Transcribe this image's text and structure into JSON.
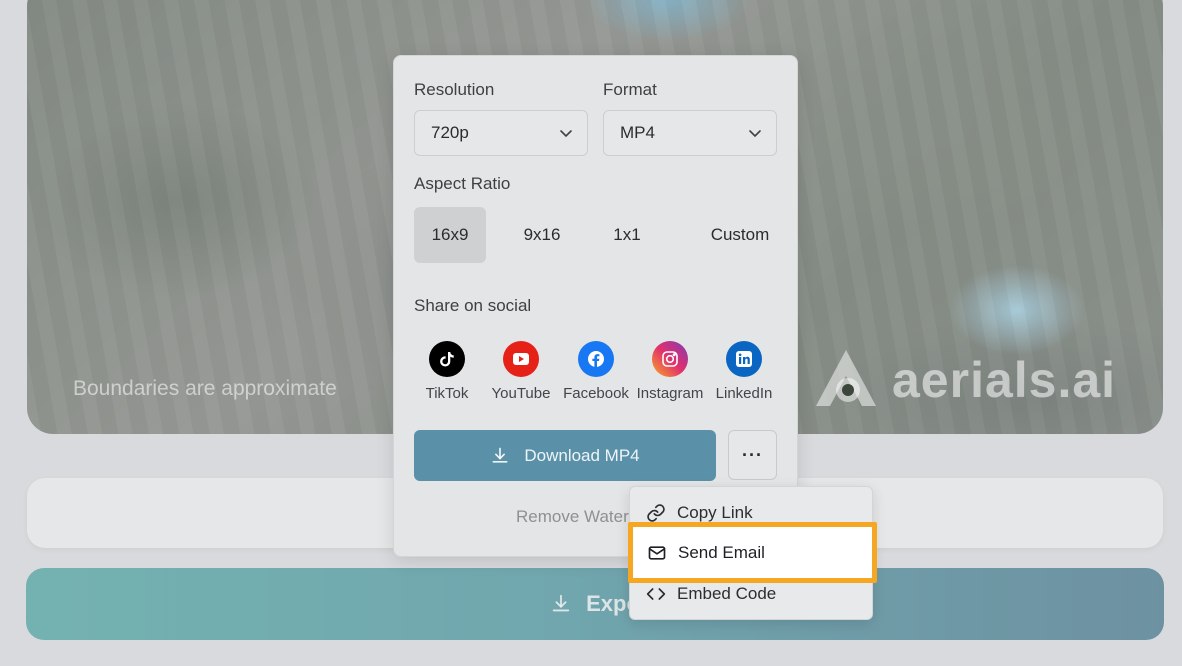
{
  "background": {
    "map_note": "Boundaries are approximate",
    "brand_name": "aerials.ai",
    "export_label": "Expo"
  },
  "panel": {
    "resolution_label": "Resolution",
    "resolution_value": "720p",
    "format_label": "Format",
    "format_value": "MP4",
    "aspect_label": "Aspect Ratio",
    "aspect_options": [
      "16x9",
      "9x16",
      "1x1",
      "Custom"
    ],
    "aspect_selected": "16x9",
    "share_label": "Share on social",
    "socials": [
      {
        "name": "TikTok",
        "color": "#000000"
      },
      {
        "name": "YouTube",
        "color": "#e62117"
      },
      {
        "name": "Facebook",
        "color": "#1877f2"
      },
      {
        "name": "Instagram",
        "color": "#d6249f"
      },
      {
        "name": "LinkedIn",
        "color": "#0a66c2"
      }
    ],
    "download_label": "Download MP4",
    "more_label": "···",
    "remove_watermark": "Remove Water"
  },
  "menu": {
    "items": [
      {
        "label": "Copy Link",
        "icon": "link-icon"
      },
      {
        "label": "Send Email",
        "icon": "mail-icon"
      },
      {
        "label": "Embed Code",
        "icon": "code-icon"
      }
    ],
    "highlighted": "Send Email"
  },
  "colors": {
    "accent": "#5a91a9",
    "highlight_border": "#f5a623",
    "export_gradient_start": "#1f8e8a",
    "export_gradient_end": "#13536e"
  }
}
